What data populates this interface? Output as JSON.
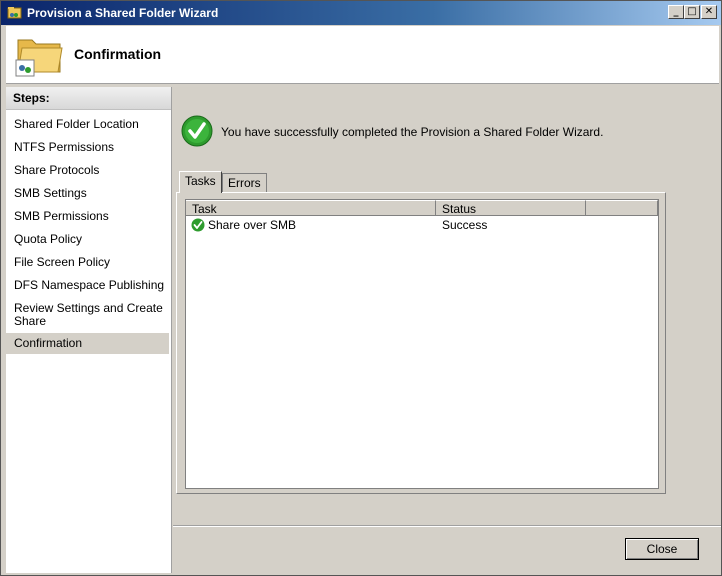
{
  "window": {
    "title": "Provision a Shared Folder Wizard"
  },
  "titlebar_buttons": {
    "minimize": "_",
    "maximize": "□",
    "close": "✕"
  },
  "header": {
    "page_title": "Confirmation"
  },
  "steps": {
    "title": "Steps:",
    "items": [
      {
        "label": "Shared Folder Location"
      },
      {
        "label": "NTFS Permissions"
      },
      {
        "label": "Share Protocols"
      },
      {
        "label": "SMB Settings"
      },
      {
        "label": "SMB Permissions"
      },
      {
        "label": "Quota Policy"
      },
      {
        "label": "File Screen Policy"
      },
      {
        "label": "DFS Namespace Publishing"
      },
      {
        "label": "Review Settings and Create Share"
      },
      {
        "label": "Confirmation"
      }
    ],
    "active_index": 9
  },
  "content": {
    "success_message": "You have successfully completed the Provision a Shared Folder Wizard.",
    "tabs": [
      {
        "label": "Tasks"
      },
      {
        "label": "Errors"
      }
    ],
    "table": {
      "columns": [
        "Task",
        "Status",
        ""
      ],
      "rows": [
        {
          "task": "Share over SMB",
          "status": "Success"
        }
      ]
    }
  },
  "footer": {
    "close_label": "Close"
  },
  "colors": {
    "titlebar_start": "#0a246a",
    "success_green": "#2e9b2e",
    "folder_yellow": "#f0c85a"
  },
  "icons": {
    "app": "folder-share-icon",
    "success": "check-circle-icon",
    "header": "shared-folder-icon"
  }
}
